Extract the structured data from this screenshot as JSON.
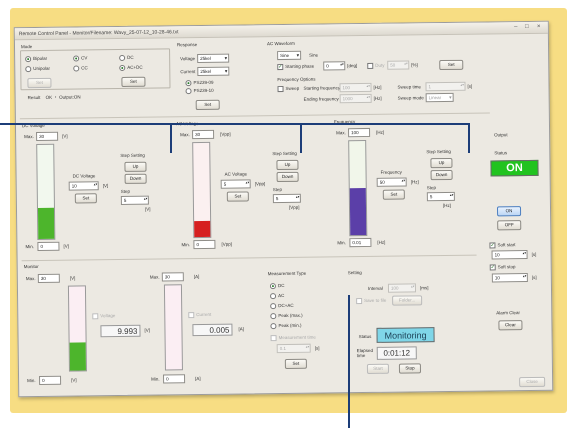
{
  "window": {
    "title": "Remote Control Panel - Monitor/Filename: Wavy_25-07-12_10-28-46.txt"
  },
  "mode": {
    "title": "Mode",
    "bipolar": "Bipolar",
    "unipolar": "Unipolar",
    "cv": "CV",
    "cc": "CC",
    "dc": "DC",
    "acdc": "AC+DC",
    "set_label": "Set",
    "set2_label": "Set",
    "result_label": "Result",
    "result_value": "OK ・ Output:ON"
  },
  "response": {
    "title": "Response",
    "voltage_label": "Voltage",
    "voltage_value": "25kel",
    "current_label": "Current",
    "current_value": "25kel",
    "opt1": "PS239-09",
    "opt2": "PS239-10",
    "set_label": "Set"
  },
  "ac_waveform": {
    "title": "AC Waveform",
    "wave_value": "Sine",
    "wave_label": "Sine",
    "starting_phase_label": "Starting phase",
    "starting_phase_value": "0",
    "phase_unit": "[deg]",
    "duty_label": "Duty",
    "duty_value": "50",
    "duty_unit": "[%]",
    "set_label": "Set",
    "freq_options_title": "Frequency Options",
    "sweep_label": "Sweep",
    "start_freq_label": "Starting frequency",
    "start_freq_value": "100",
    "hz1": "[Hz]",
    "end_freq_label": "Ending frequency",
    "end_freq_value": "1000",
    "hz2": "[Hz]",
    "sweep_time_label": "Sweep time",
    "sweep_time_value": "1",
    "sweep_time_unit": "[s]",
    "sweep_mode_label": "Sweep mode",
    "sweep_mode_value": "Linear"
  },
  "dc_voltage": {
    "title": "DC Voltage",
    "max_label": "Max.",
    "max_value": "30",
    "max_unit": "[V]",
    "min_label": "Min.",
    "min_value": "0",
    "min_unit": "[V]",
    "field_label": "DC Voltage",
    "field_value": "10",
    "field_unit": "[V]",
    "set_label": "Set",
    "step_title": "Step Setting",
    "up_label": "Up",
    "down_label": "Down",
    "step_label": "Step",
    "step_value": "5",
    "step_unit": "[V]",
    "level": 0.33,
    "color": "#4db52c"
  },
  "ac_voltage": {
    "title": "AC Voltage",
    "max_label": "Max.",
    "max_value": "30",
    "max_unit": "[Vpp]",
    "min_label": "Min.",
    "min_value": "0",
    "min_unit": "[Vpp]",
    "field_label": "AC Voltage",
    "field_value": "5",
    "field_unit": "[Vpp]",
    "set_label": "Set",
    "step_title": "Step Setting",
    "up_label": "Up",
    "down_label": "Down",
    "step_label": "Step",
    "step_value": "5",
    "step_unit": "[Vpp]",
    "level": 0.17,
    "color": "#d62020"
  },
  "frequency": {
    "title": "Frequency",
    "max_label": "Max.",
    "max_value": "100",
    "max_unit": "[Hz]",
    "min_label": "Min.",
    "min_value": "0.01",
    "min_unit": "[Hz]",
    "field_label": "Frequency",
    "field_value": "50",
    "field_unit": "[Hz]",
    "set_label": "Set",
    "step_title": "Step Setting",
    "up_label": "Up",
    "down_label": "Down",
    "step_label": "Step",
    "step_value": "5",
    "step_unit": "[Hz]",
    "level": 0.5,
    "color": "#5b3fa8"
  },
  "output": {
    "title": "Output",
    "status_label": "Status",
    "status_value": "ON",
    "status_color": "#21c31f",
    "on_label": "ON",
    "off_label": "OFF",
    "soft_start_label": "Soft start",
    "soft_start_value": "10",
    "soft_start_unit": "[s]",
    "soft_stop_label": "Soft stop",
    "soft_stop_value": "10",
    "soft_stop_unit": "[s]"
  },
  "monitor": {
    "title": "Monitor",
    "v_max_label": "Max.",
    "v_max_value": "30",
    "v_max_unit": "[V]",
    "v_min_label": "Min.",
    "v_min_value": "0",
    "v_min_unit": "[V]",
    "voltage_label": "Voltage",
    "voltage_value": "9.993",
    "voltage_unit": "[V]",
    "voltage_level": 0.33,
    "a_max_label": "Max.",
    "a_max_value": "30",
    "a_max_unit": "[A]",
    "a_min_label": "Min.",
    "a_min_value": "0",
    "a_min_unit": "[A]",
    "current_label": "Current",
    "current_value": "0.005",
    "current_unit": "[A]",
    "current_level": 0.0
  },
  "measurement": {
    "title": "Measurement Type",
    "options": [
      "DC",
      "AC",
      "DC+AC",
      "Peak (max.)",
      "Peak (min.)"
    ],
    "measurement_time_label": "Measurement time",
    "measurement_time_value": "0.1",
    "measurement_time_unit": "[s]",
    "set_label": "Set"
  },
  "setting": {
    "title": "Setting",
    "interval_label": "Interval",
    "interval_value": "100",
    "interval_unit": "[ms]",
    "save_label": "Save to file",
    "folder_label": "Folder...",
    "status_label": "Status",
    "status_value": "Monitoring",
    "status_color": "#7fd6e8",
    "elapsed_label": "Elapsed time",
    "elapsed_value": "0:01:12",
    "start_label": "Start",
    "stop_label": "Stop"
  },
  "alarm": {
    "title": "Alarm Clear",
    "clear_label": "Clear"
  },
  "footer": {
    "close_label": "Close"
  }
}
